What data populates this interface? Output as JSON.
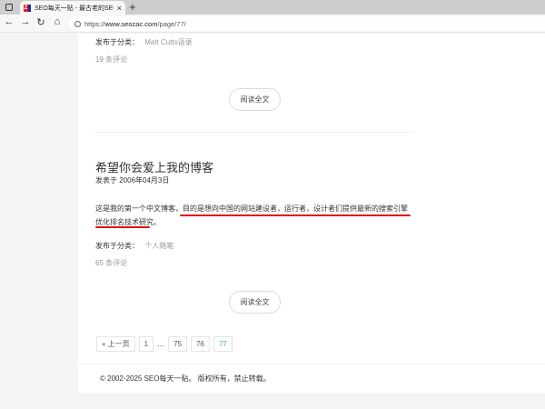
{
  "browser": {
    "tab_title": "SEO每天一贴 - 最古老的SEO优化",
    "url_prefix": "https://",
    "url_host": "www.seozac.com",
    "url_path": "/page/77/",
    "new_tab": "+",
    "close": "×"
  },
  "post1": {
    "category_label": "发布于分类：",
    "category": "Matt Cutts语录",
    "comments": "19 条评论",
    "read_more": "阅读全文"
  },
  "post2": {
    "title": "希望你会爱上我的博客",
    "date": "发表于 2006年04月3日",
    "body_plain": "这是我的第一个中文博客，",
    "body_highlight1": "目的是想向中国的网站建设者，运行者，设计者们提供最新的搜索引擎优",
    "body_highlight2": "化排名技术研究。",
    "category_label": "发布于分类：",
    "category": "个人随笔",
    "comments": "65 条评论",
    "read_more": "阅读全文"
  },
  "pagination": {
    "prev": "« 上一页",
    "pages": [
      "1",
      "75",
      "76",
      "77"
    ],
    "ellipsis": "…",
    "current": "77"
  },
  "footer": {
    "text": "© 2002-2025 SEO每天一贴。 版权所有，禁止转载。"
  },
  "colors": {
    "highlight_underline": "#dd1111",
    "current_page": "#3bb4c9"
  }
}
